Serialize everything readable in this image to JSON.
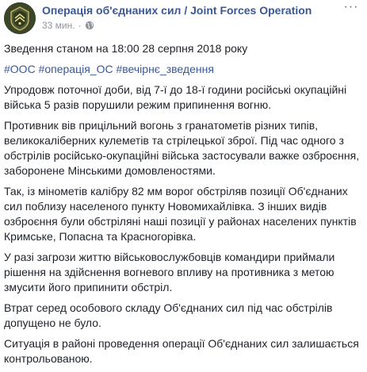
{
  "post": {
    "page_name": "Операція об'єднаних сил / Joint Forces Operation",
    "timestamp": "33 мин.",
    "separator": "·",
    "avatar_icon": "jfo-emblem-icon",
    "privacy_icon": "globe-icon",
    "more_icon": "more-options-icon",
    "more_label": "···",
    "paragraphs": [
      "Зведення станом на 18:00 28 серпня 2018 року",
      "Упродовж поточної доби, від 7-ї до 18-ї години російські окупаційні війська 5 разів порушили режим припинення вогню.",
      "Противник вів прицільний вогонь з гранатометів різних типів, великокаліберних кулеметів та стрілецької зброї. Під час одного з обстрілів російсько-окупаційні війська застосували важке озброєння, заборонене Мінськими домовленостями.",
      "Так, із мінометів калібру 82 мм ворог обстріляв позиції Об'єднаних сил поблизу населеного пункту Новомихайлівка. З інших видів озброєння були обстріляні наші позиції у районах населених пунктів Кримське, Попасна та Красногорівка.",
      "У разі загрози життю військовослужбовців командири приймали рішення на здійснення вогневого впливу на противника з метою змусити його припинити обстріл.",
      "Втрат серед особового складу Об'єднаних сил під час обстрілів допущено не було.",
      "Ситуація в районі проведення операції Об'єднаних сил залишається контрольованою."
    ],
    "hashtags": [
      "#ООС",
      "#операція_ОС",
      "#вечірнє_зведення"
    ]
  },
  "colors": {
    "link": "#385898",
    "text": "#1d2129",
    "meta": "#90949c"
  }
}
